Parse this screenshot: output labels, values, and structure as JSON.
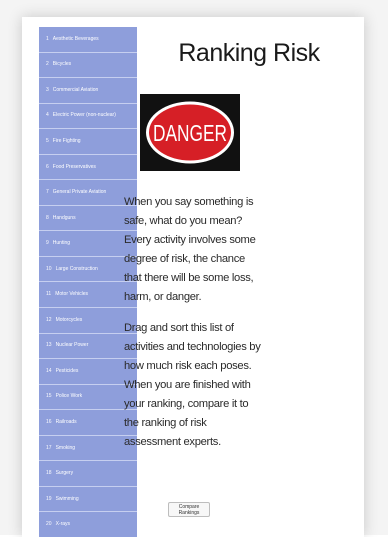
{
  "page": {
    "title": "Ranking Risk",
    "sign_text": "DANGER",
    "paragraph_1": "When you say something is safe, what do you mean? Every activity involves some degree of risk, the chance that there will be some loss, harm, or danger.",
    "paragraph_2": "Drag and sort this list of activities and technologies by how much risk each poses. When you are finished with your ranking, compare it to the ranking of risk assessment experts.",
    "compare_button_label": "Compare Rankings"
  },
  "colors": {
    "sidebar_bg": "#8e9edb",
    "sign_red": "#d61f26",
    "sign_black": "#111111"
  },
  "sidebar": {
    "items": [
      {
        "num": "1",
        "label": "Aesthetic Beverages"
      },
      {
        "num": "2",
        "label": "Bicycles"
      },
      {
        "num": "3",
        "label": "Commercial Aviation"
      },
      {
        "num": "4",
        "label": "Electric Power (non-nuclear)"
      },
      {
        "num": "5",
        "label": "Fire Fighting"
      },
      {
        "num": "6",
        "label": "Food Preservatives"
      },
      {
        "num": "7",
        "label": "General Private Aviation"
      },
      {
        "num": "8",
        "label": "Handguns"
      },
      {
        "num": "9",
        "label": "Hunting"
      },
      {
        "num": "10",
        "label": "Large Construction"
      },
      {
        "num": "11",
        "label": "Motor Vehicles"
      },
      {
        "num": "12",
        "label": "Motorcycles"
      },
      {
        "num": "13",
        "label": "Nuclear Power"
      },
      {
        "num": "14",
        "label": "Pesticides"
      },
      {
        "num": "15",
        "label": "Police Work"
      },
      {
        "num": "16",
        "label": "Railroads"
      },
      {
        "num": "17",
        "label": "Smoking"
      },
      {
        "num": "18",
        "label": "Surgery"
      },
      {
        "num": "19",
        "label": "Swimming"
      },
      {
        "num": "20",
        "label": "X-rays"
      }
    ]
  }
}
